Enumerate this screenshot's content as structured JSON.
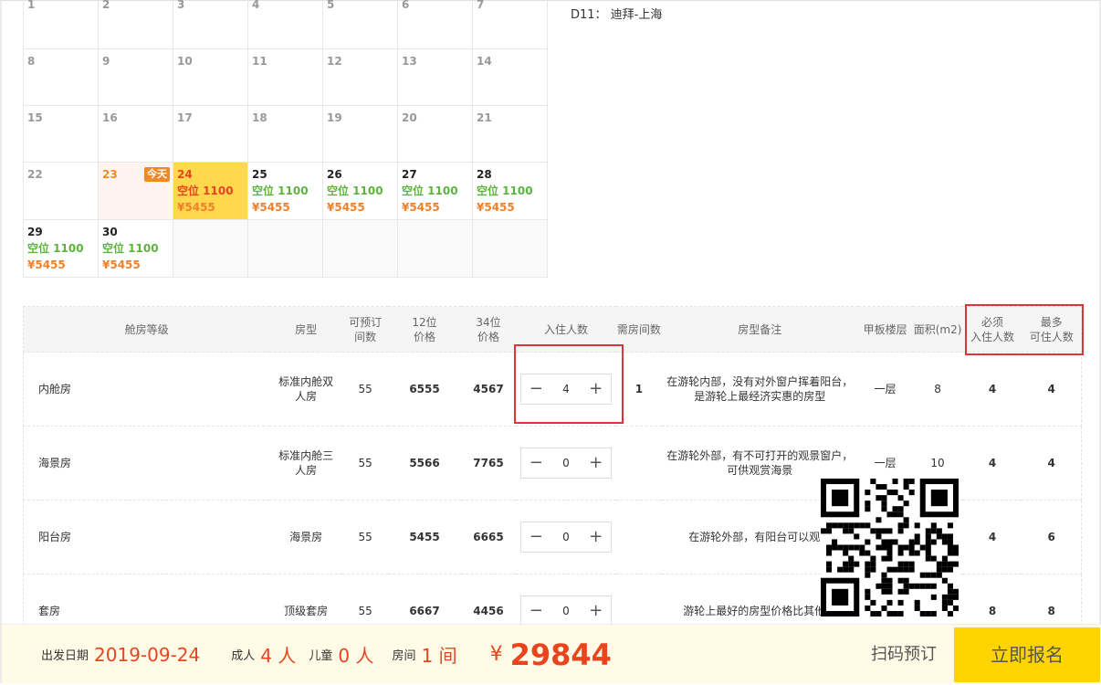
{
  "calendar": {
    "weeks": [
      [
        {
          "day": "1"
        },
        {
          "day": "2"
        },
        {
          "day": "3"
        },
        {
          "day": "4"
        },
        {
          "day": "5"
        },
        {
          "day": "6"
        },
        {
          "day": "7"
        }
      ],
      [
        {
          "day": "8"
        },
        {
          "day": "9"
        },
        {
          "day": "10"
        },
        {
          "day": "11"
        },
        {
          "day": "12"
        },
        {
          "day": "13"
        },
        {
          "day": "14"
        }
      ],
      [
        {
          "day": "15"
        },
        {
          "day": "16"
        },
        {
          "day": "17"
        },
        {
          "day": "18"
        },
        {
          "day": "19"
        },
        {
          "day": "20"
        },
        {
          "day": "21"
        }
      ],
      [
        {
          "day": "22"
        },
        {
          "day": "23",
          "today": "今天"
        },
        {
          "day": "24",
          "vacancy": "空位 1100",
          "price": "¥5455",
          "selected": true
        },
        {
          "day": "25",
          "vacancy": "空位 1100",
          "price": "¥5455"
        },
        {
          "day": "26",
          "vacancy": "空位 1100",
          "price": "¥5455"
        },
        {
          "day": "27",
          "vacancy": "空位 1100",
          "price": "¥5455"
        },
        {
          "day": "28",
          "vacancy": "空位 1100",
          "price": "¥5455"
        }
      ],
      [
        {
          "day": "29",
          "vacancy": "空位 1100",
          "price": "¥5455"
        },
        {
          "day": "30",
          "vacancy": "空位 1100",
          "price": "¥5455"
        },
        {},
        {},
        {},
        {},
        {}
      ]
    ]
  },
  "route": "D11： 迪拜-上海",
  "table": {
    "headers": {
      "level": "舱房等级",
      "type": "房型",
      "available_l1": "可预订",
      "available_l2": "间数",
      "p12_l1": "12位",
      "p12_l2": "价格",
      "p34_l1": "34位",
      "p34_l2": "价格",
      "guests": "入住人数",
      "rooms_needed": "需房间数",
      "note": "房型备注",
      "deck": "甲板楼层",
      "area": "面积(m2)",
      "min_l1": "必须",
      "min_l2": "入住人数",
      "max_l1": "最多",
      "max_l2": "可住人数"
    },
    "rows": [
      {
        "level": "内舱房",
        "type_l1": "标准内舱双",
        "type_l2": "人房",
        "available": "55",
        "p12": "6555",
        "p34": "4567",
        "guests": "4",
        "rooms": "1",
        "note_l1": "在游轮内部，没有对外窗户挥着阳台，",
        "note_l2": "是游轮上最经济实惠的房型",
        "deck": "一层",
        "area": "8",
        "min": "4",
        "max": "4"
      },
      {
        "level": "海景房",
        "type_l1": "标准内舱三",
        "type_l2": "人房",
        "available": "55",
        "p12": "5566",
        "p34": "7765",
        "guests": "0",
        "rooms": "",
        "note_l1": "在游轮外部，有不可打开的观景窗户，",
        "note_l2": "可供观赏海景",
        "deck": "一层",
        "area": "10",
        "min": "4",
        "max": "4"
      },
      {
        "level": "阳台房",
        "type_l1": "海景房",
        "type_l2": "",
        "available": "55",
        "p12": "5455",
        "p34": "6665",
        "guests": "0",
        "rooms": "",
        "note_l1": "在游轮外部，有阳台可以观赏",
        "note_l2": "",
        "deck": "",
        "area": "",
        "min": "4",
        "max": "6"
      },
      {
        "level": "套房",
        "type_l1": "顶级套房",
        "type_l2": "",
        "available": "55",
        "p12": "6667",
        "p34": "4456",
        "guests": "0",
        "rooms": "",
        "note_l1": "游轮上最好的房型价格比其他房",
        "note_l2": "",
        "deck": "",
        "area": "",
        "min": "8",
        "max": "8"
      }
    ],
    "minus": "−",
    "plus": "+"
  },
  "bottom": {
    "date_label": "出发日期",
    "date_value": "2019-09-24",
    "adult_label": "成人",
    "adult_value": "4 人",
    "child_label": "儿童",
    "child_value": "0 人",
    "room_label": "房间",
    "room_value": "1 间",
    "currency": "¥",
    "total": "29844",
    "scan_label": "扫码预订",
    "signup_label": "立即报名"
  },
  "colors": {
    "accent_red": "#e8451e",
    "vacancy_green": "#5db33d",
    "highlight_yellow": "#ffd84d",
    "button_yellow": "#ffd400",
    "box_red": "#e0343a"
  }
}
